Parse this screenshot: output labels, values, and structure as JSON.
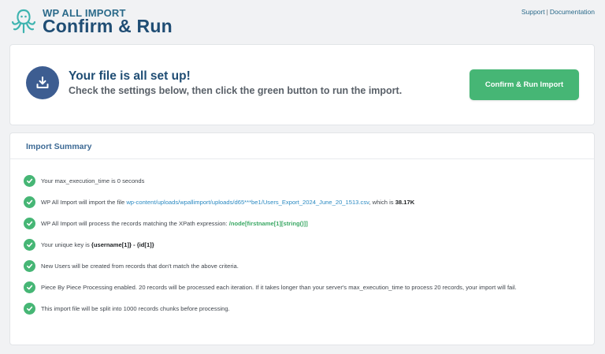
{
  "header": {
    "brand_small": "WP ALL IMPORT",
    "page_title": "Confirm & Run",
    "links": {
      "support": "Support",
      "separator": "|",
      "documentation": "Documentation"
    }
  },
  "hero": {
    "title": "Your file is all set up!",
    "subtitle": "Check the settings below, then click the green button to run the import.",
    "button_label": "Confirm & Run Import"
  },
  "summary": {
    "title": "Import Summary",
    "items": [
      {
        "text": "Your max_execution_time is 0 seconds"
      },
      {
        "prefix": "WP All Import will import the file ",
        "link": "wp-content/uploads/wpallimport/uploads/d65***be1/Users_Export_2024_June_20_1513.csv",
        "middle": ", which is ",
        "size": "38.17K"
      },
      {
        "prefix": "WP All Import will process the records matching the XPath expression: ",
        "xpath": "/node[firstname[1][string()]]"
      },
      {
        "prefix": "Your unique key is ",
        "key": "{username[1]} - {id[1]}"
      },
      {
        "text": "New Users will be created from records that don't match the above criteria."
      },
      {
        "text": "Piece By Piece Processing enabled. 20 records will be processed each iteration. If it takes longer than your server's max_execution_time to process 20 records, your import will fail."
      },
      {
        "text": "This import file will be split into 1000 records chunks before processing."
      }
    ]
  },
  "colors": {
    "accent_green": "#46b675",
    "brand_blue": "#1f4d74",
    "icon_circle": "#3d5d91",
    "link_blue": "#2b8ac2"
  },
  "icons": {
    "logo": "octopus-logo-icon",
    "hero": "download-tray-icon",
    "check": "check-circle-icon"
  }
}
